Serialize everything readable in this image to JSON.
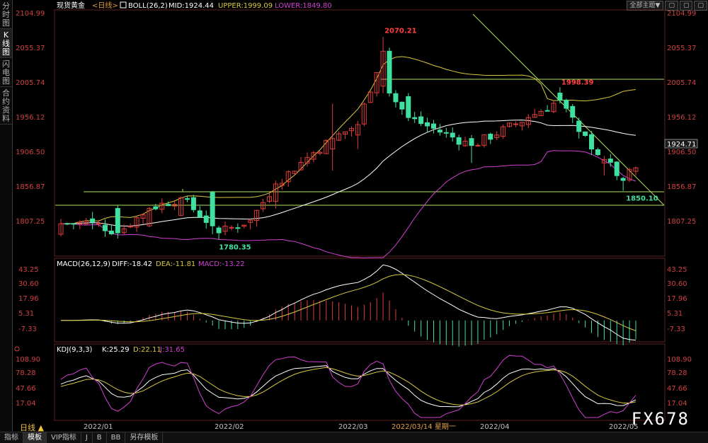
{
  "sidebar": {
    "tabs": [
      "分时图",
      "K线图",
      "闪电图",
      "合约资料"
    ]
  },
  "top_buttons": [
    "全部主题▼",
    "▢",
    "▢",
    "▢"
  ],
  "main_header": {
    "name": "现货黄金",
    "period": "<日线>",
    "boll": "BOLL(26,2)",
    "mid": "MID:1924.44",
    "upper": "UPPER:1999.09",
    "lower": "LOWER:1849.80"
  },
  "macd_header": {
    "name": "MACD(26,12,9)",
    "diff": "DIFF:-18.42",
    "dea": "DEA:-11.81",
    "macd": "MACD:-13.22"
  },
  "kdj_header": {
    "name": "KDJ(9,3,3)",
    "k": "K:25.29",
    "d": "D:22.11",
    "j": "J:31.65"
  },
  "price_axis_labels": [
    "2104.99",
    "2055.37",
    "2005.74",
    "1956.12",
    "1906.50",
    "1856.87",
    "1807.25"
  ],
  "current_price": "1924.71",
  "macd_axis_labels": [
    "43.25",
    "30.60",
    "17.96",
    "5.31",
    "-7.33"
  ],
  "kdj_axis_labels": [
    "108.90",
    "78.28",
    "47.66",
    "17.04"
  ],
  "x_axis_labels": [
    "2022/01",
    "2022/02",
    "2022/03",
    "2022/03/14 星期一",
    "2022/04",
    "2022/05"
  ],
  "annotations": {
    "high": "2070.21",
    "secondary_high": "1998.39",
    "low": "1780.35",
    "recent_low": "1850.10"
  },
  "period_label": "日线 ▲",
  "bottom_tabs": [
    "指标",
    "模板",
    "VIP指标",
    "J",
    "B",
    "BB",
    "另存模板"
  ],
  "watermark": "FX678",
  "colors": {
    "up": "#e03c3c",
    "down": "#40e0a0",
    "mid": "#ffffff",
    "upper": "#d8c840",
    "lower": "#d040d0",
    "support": "#b0e060"
  },
  "chart_data": {
    "type": "candlestick",
    "series_name": "现货黄金",
    "period": "日线",
    "x_range": [
      "2021-12-22",
      "2022-05-06"
    ],
    "ylim": [
      1760,
      2110
    ],
    "ohlc_sampled": [
      {
        "d": "2021-12-22",
        "o": 1788,
        "h": 1810,
        "l": 1785,
        "c": 1803
      },
      {
        "d": "2021-12-29",
        "o": 1810,
        "h": 1820,
        "l": 1795,
        "c": 1805
      },
      {
        "d": "2022-01-05",
        "o": 1825,
        "h": 1830,
        "l": 1782,
        "c": 1790
      },
      {
        "d": "2022-01-12",
        "o": 1800,
        "h": 1827,
        "l": 1798,
        "c": 1825
      },
      {
        "d": "2022-01-19",
        "o": 1815,
        "h": 1842,
        "l": 1814,
        "c": 1840
      },
      {
        "d": "2022-01-26",
        "o": 1848,
        "h": 1850,
        "l": 1788,
        "c": 1800
      },
      {
        "d": "2022-01-28",
        "o": 1797,
        "h": 1800,
        "l": 1780.35,
        "c": 1790
      },
      {
        "d": "2022-02-04",
        "o": 1805,
        "h": 1810,
        "l": 1795,
        "c": 1808
      },
      {
        "d": "2022-02-11",
        "o": 1835,
        "h": 1865,
        "l": 1825,
        "c": 1860
      },
      {
        "d": "2022-02-18",
        "o": 1890,
        "h": 1905,
        "l": 1885,
        "c": 1898
      },
      {
        "d": "2022-02-24",
        "o": 1910,
        "h": 1975,
        "l": 1879,
        "c": 1925
      },
      {
        "d": "2022-03-02",
        "o": 1930,
        "h": 1950,
        "l": 1910,
        "c": 1945
      },
      {
        "d": "2022-03-08",
        "o": 2000,
        "h": 2070.21,
        "l": 1990,
        "c": 2050
      },
      {
        "d": "2022-03-09",
        "o": 2050,
        "h": 2055,
        "l": 1985,
        "c": 1990
      },
      {
        "d": "2022-03-14",
        "o": 1985,
        "h": 1990,
        "l": 1950,
        "c": 1955
      },
      {
        "d": "2022-03-29",
        "o": 1925,
        "h": 1930,
        "l": 1890,
        "c": 1915
      },
      {
        "d": "2022-04-11",
        "o": 1945,
        "h": 1960,
        "l": 1940,
        "c": 1955
      },
      {
        "d": "2022-04-18",
        "o": 1990,
        "h": 1998.39,
        "l": 1975,
        "c": 1980
      },
      {
        "d": "2022-04-22",
        "o": 1950,
        "h": 1955,
        "l": 1925,
        "c": 1935
      },
      {
        "d": "2022-04-28",
        "o": 1890,
        "h": 1900,
        "l": 1872,
        "c": 1895
      },
      {
        "d": "2022-05-03",
        "o": 1868,
        "h": 1870,
        "l": 1850.1,
        "c": 1865
      },
      {
        "d": "2022-05-06",
        "o": 1878,
        "h": 1885,
        "l": 1872,
        "c": 1883
      }
    ],
    "boll": {
      "mid": 1924.44,
      "upper": 1999.09,
      "lower": 1849.8
    },
    "macd": {
      "diff": -18.42,
      "dea": -11.81,
      "macd": -13.22,
      "ylim": [
        -12,
        45
      ]
    },
    "kdj": {
      "k": 25.29,
      "d": 22.11,
      "j": 31.65,
      "ylim": [
        10,
        110
      ]
    }
  }
}
